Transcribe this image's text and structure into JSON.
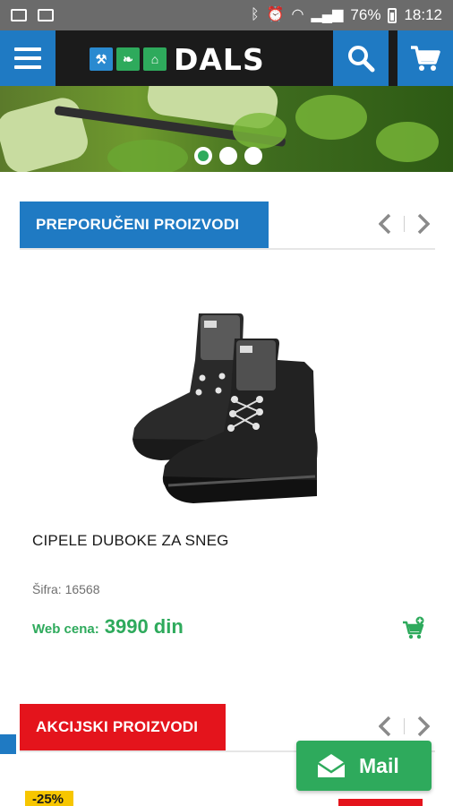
{
  "status_bar": {
    "battery": "76%",
    "time": "18:12"
  },
  "header": {
    "logo_text": "DALS"
  },
  "banner": {
    "slides": 3,
    "active_slide": 1
  },
  "recommended": {
    "title": "PREPORUČENI PROIZVODI",
    "product": {
      "name": "CIPELE DUBOKE ZA SNEG",
      "sku": "Šifra: 16568",
      "price_label": "Web cena:",
      "price": "3990 din"
    }
  },
  "sale": {
    "title": "AKCIJSKI PROIZVODI",
    "badge": "-25%"
  },
  "mail_button": {
    "label": "Mail"
  },
  "colors": {
    "brand_blue": "#1f7ac3",
    "brand_green": "#2eaa5c",
    "sale_red": "#e4141c",
    "header_dark": "#1b1b1b"
  }
}
